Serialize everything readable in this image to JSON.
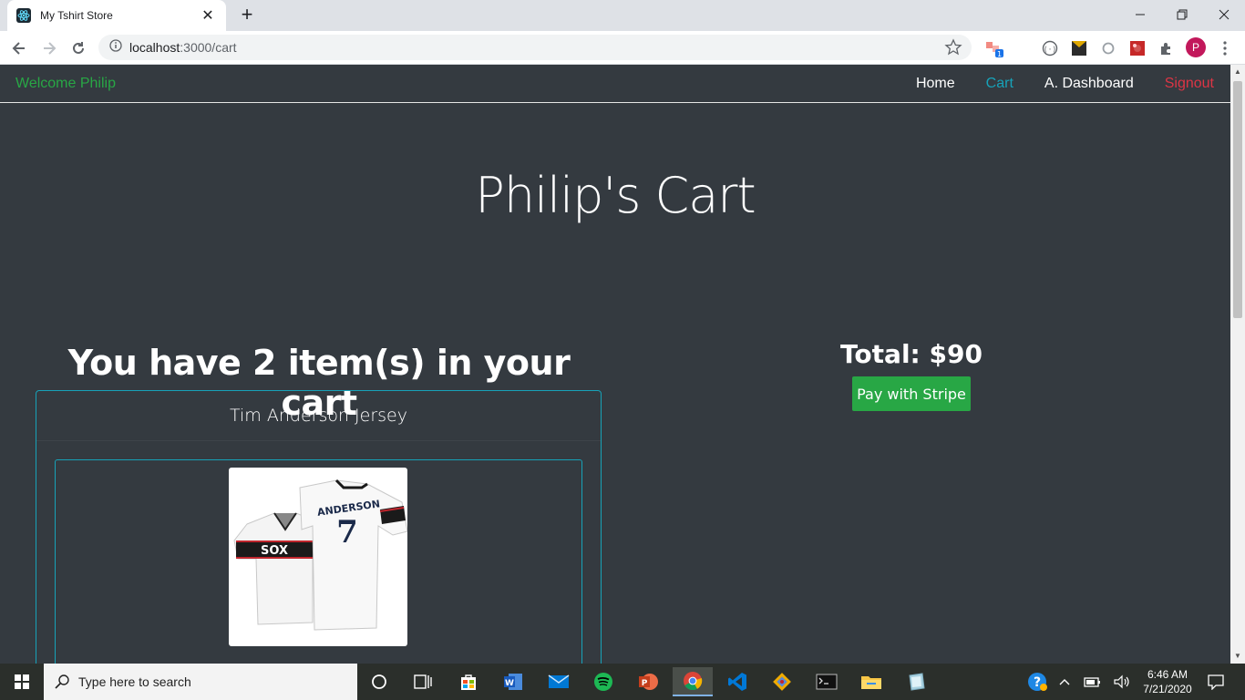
{
  "browser": {
    "tab_title": "My Tshirt Store",
    "tab_close": "✕",
    "new_tab": "+",
    "url_host": "localhost",
    "url_rest": ":3000/cart",
    "profile_initial": "P",
    "extension_badge": "1"
  },
  "navbar": {
    "welcome": "Welcome Philip",
    "links": [
      {
        "label": "Home",
        "color": "#ffffff"
      },
      {
        "label": "Cart",
        "color": "#17a2b8"
      },
      {
        "label": "A. Dashboard",
        "color": "#ffffff"
      },
      {
        "label": "Signout",
        "color": "#dc3545"
      }
    ]
  },
  "hero": {
    "title": "Philip's Cart"
  },
  "cart": {
    "count_heading": "You have 2 item(s) in your cart",
    "item": {
      "name": "Tim Anderson Jersey",
      "jersey_back_name": "ANDERSON",
      "jersey_number": "7",
      "jersey_front_text": "SOX"
    }
  },
  "checkout": {
    "total": "Total: $90",
    "pay_button": "Pay with Stripe"
  },
  "taskbar": {
    "search_placeholder": "Type here to search",
    "time": "6:46 AM",
    "date": "7/21/2020"
  },
  "colors": {
    "page_bg": "#343a40",
    "success": "#28a745",
    "info": "#17a2b8",
    "danger": "#dc3545"
  }
}
